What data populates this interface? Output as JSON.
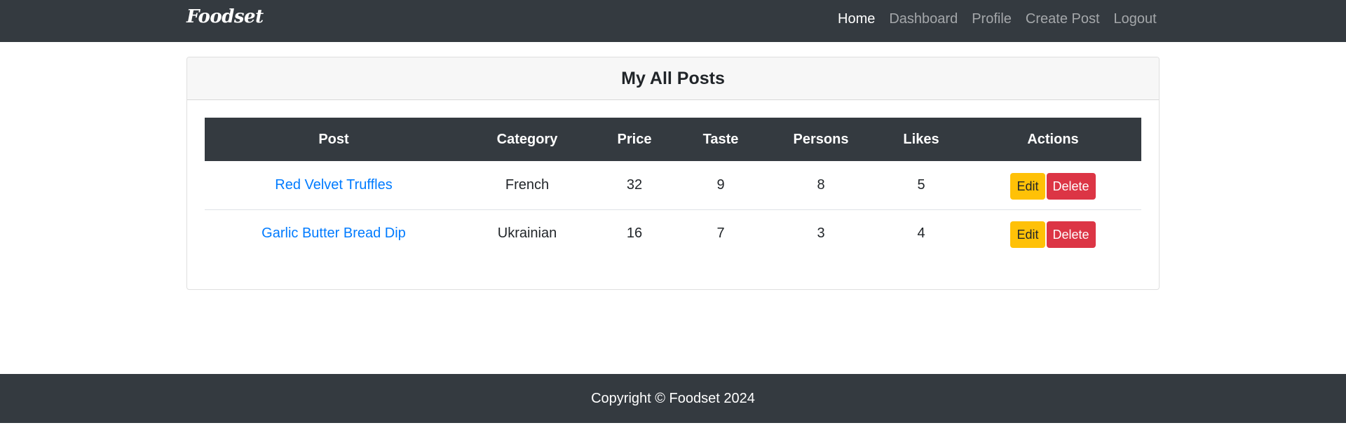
{
  "brand": "Foodset",
  "nav": {
    "links": [
      "Home",
      "Dashboard",
      "Profile",
      "Create Post",
      "Logout"
    ],
    "active": "Home"
  },
  "card": {
    "title": "My All Posts"
  },
  "table": {
    "headers": [
      "Post",
      "Category",
      "Price",
      "Taste",
      "Persons",
      "Likes",
      "Actions"
    ],
    "rows": [
      {
        "post": "Red Velvet Truffles",
        "category": "French",
        "price": "32",
        "taste": "9",
        "persons": "8",
        "likes": "5"
      },
      {
        "post": "Garlic Butter Bread Dip",
        "category": "Ukrainian",
        "price": "16",
        "taste": "7",
        "persons": "3",
        "likes": "4"
      }
    ],
    "edit_label": "Edit",
    "delete_label": "Delete"
  },
  "footer": {
    "text": "Copyright © Foodset 2024"
  },
  "colors": {
    "navbar": "#343a40",
    "link": "#007bff",
    "edit": "#ffc107",
    "delete": "#dc3545"
  }
}
